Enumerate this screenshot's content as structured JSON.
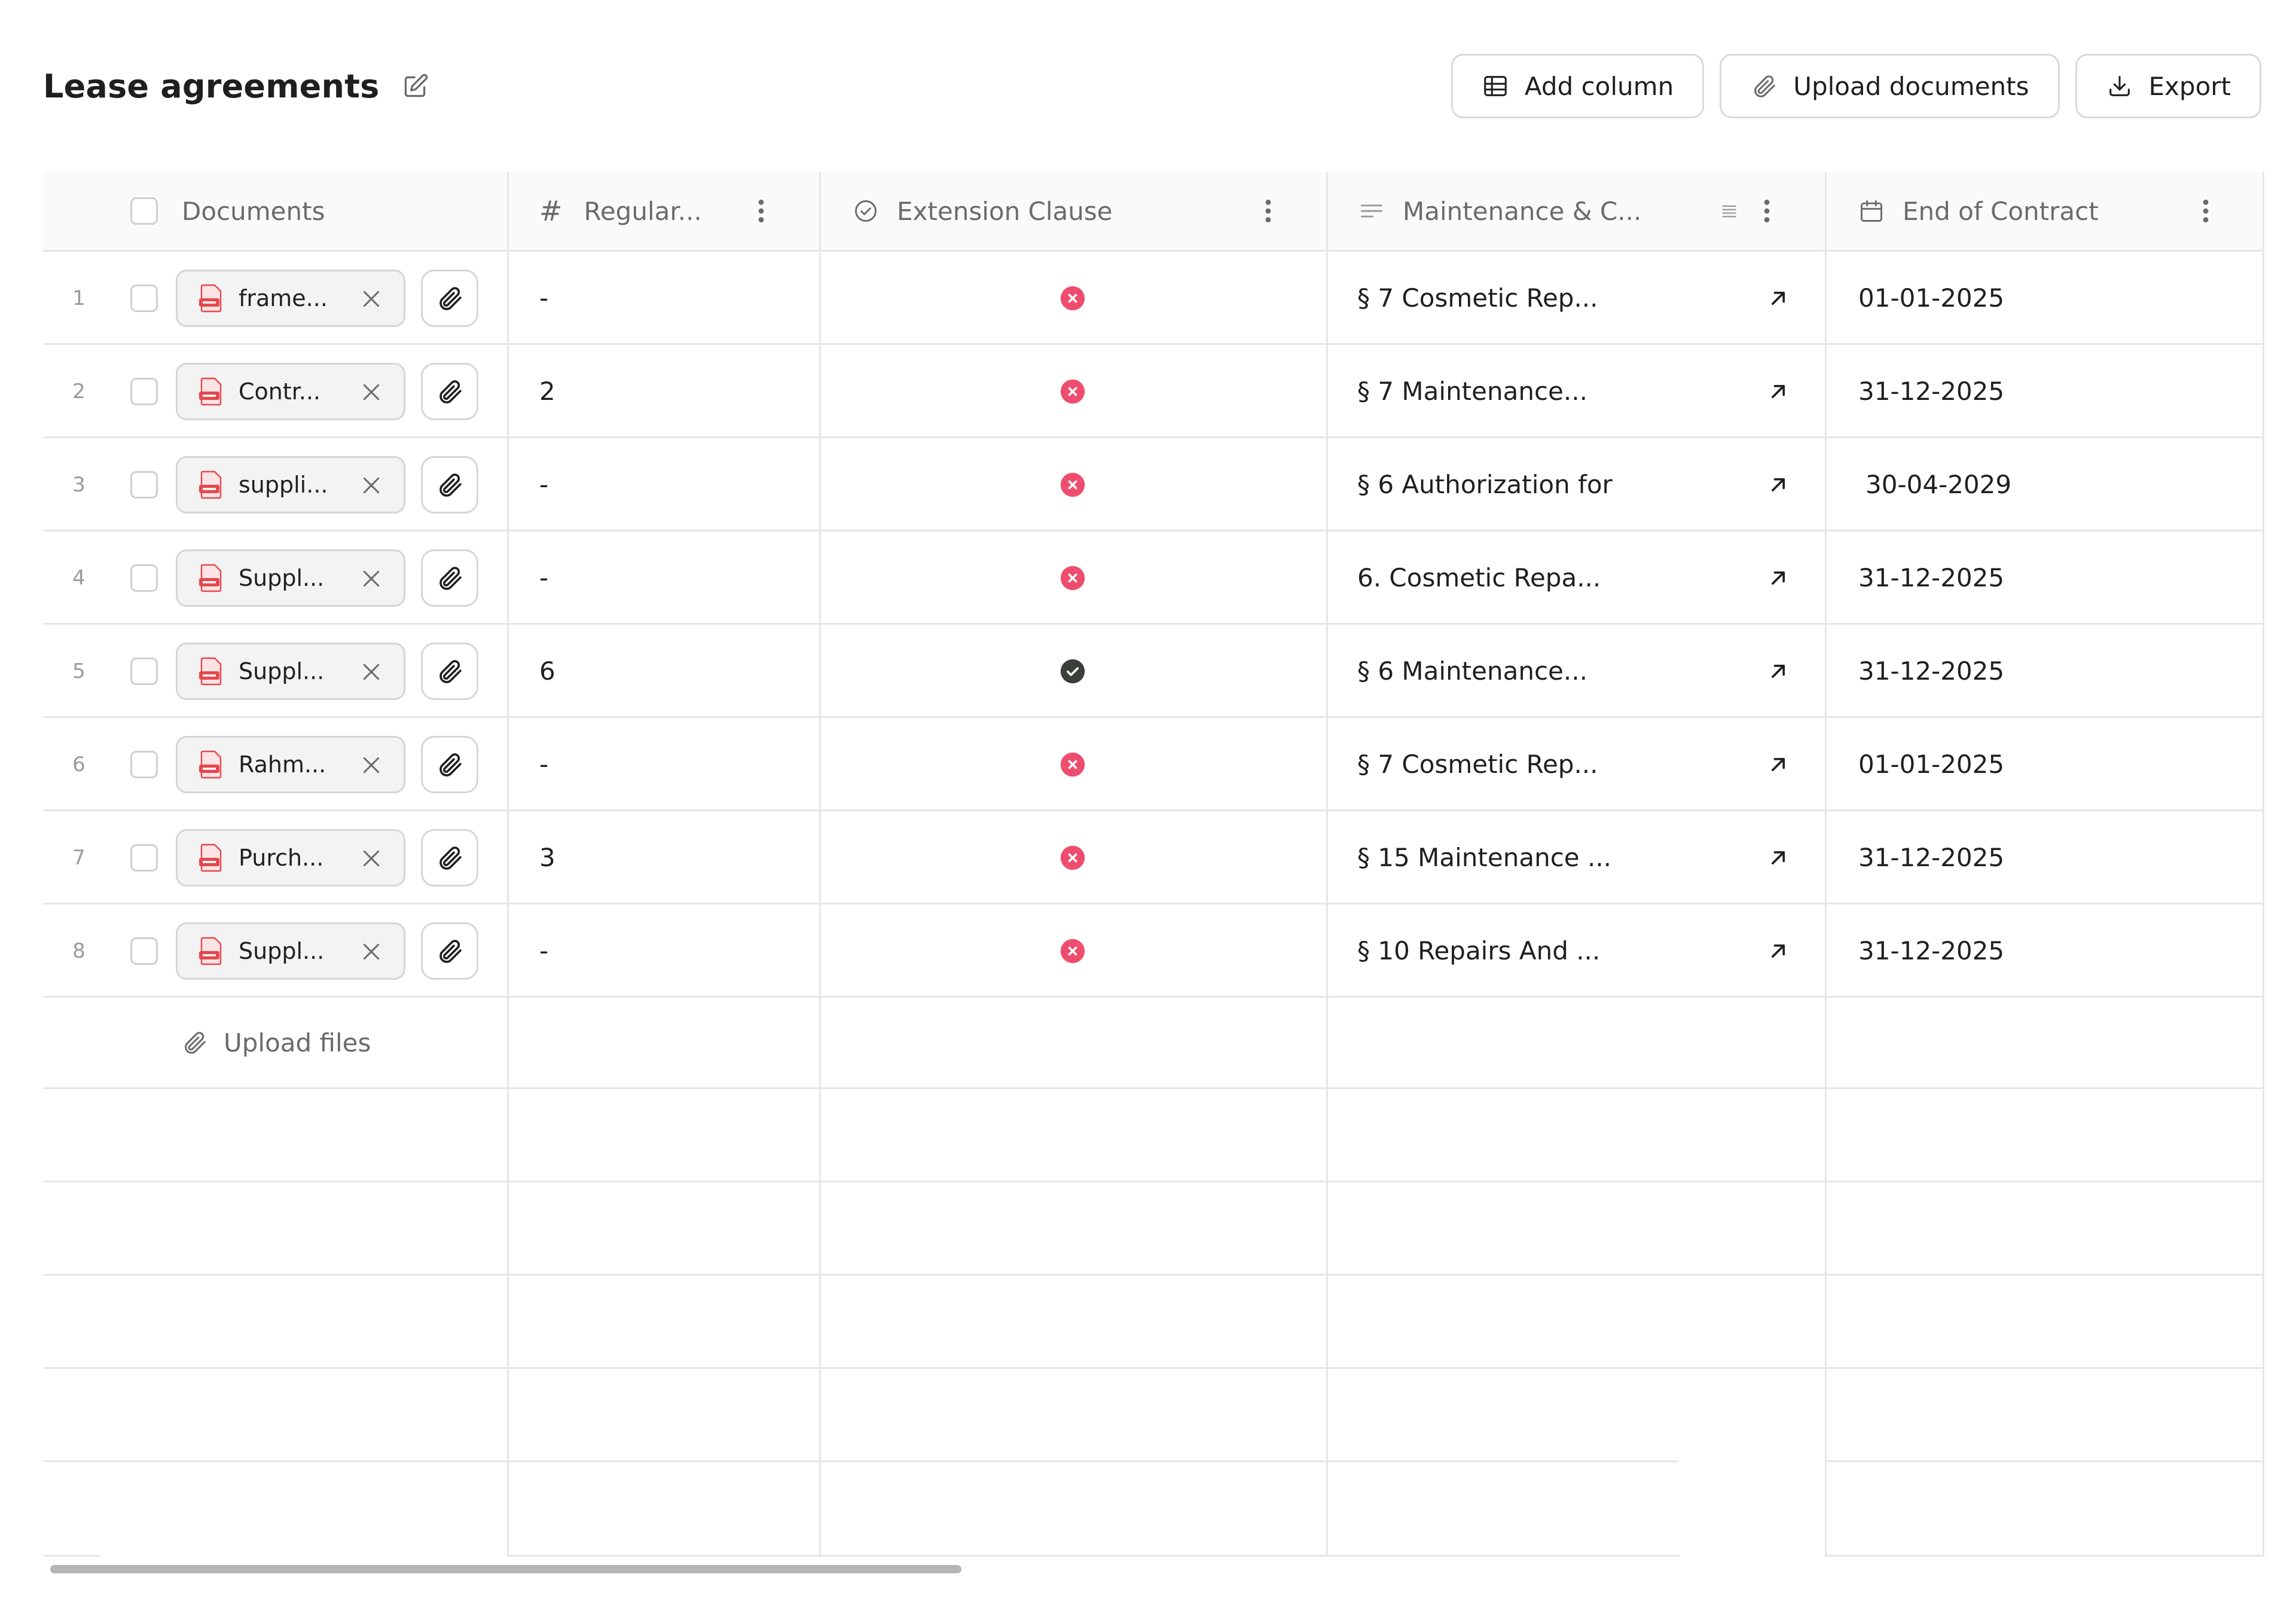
{
  "header": {
    "title": "Lease agreements",
    "edit_icon": "edit-icon"
  },
  "toolbar": {
    "add_column": "Add column",
    "upload_documents": "Upload documents",
    "export": "Export"
  },
  "columns": {
    "documents": "Documents",
    "regular": "Regular...",
    "extension": "Extension Clause",
    "maintenance": "Maintenance & C...",
    "end": "End of Contract"
  },
  "rows": [
    {
      "num": "1",
      "file": "frame...",
      "regular": "-",
      "extension": false,
      "maintenance": "§ 7 Cosmetic Rep...",
      "end": "01-01-2025"
    },
    {
      "num": "2",
      "file": "Contr...",
      "regular": "2",
      "extension": false,
      "maintenance": "§ 7 Maintenance...",
      "end": "31-12-2025"
    },
    {
      "num": "3",
      "file": "suppli...",
      "regular": "-",
      "extension": false,
      "maintenance": "§ 6 Authorization for",
      "end": "30-04-2029"
    },
    {
      "num": "4",
      "file": "Suppl...",
      "regular": "-",
      "extension": false,
      "maintenance": "6. Cosmetic Repa...",
      "end": "31-12-2025"
    },
    {
      "num": "5",
      "file": "Suppl...",
      "regular": "6",
      "extension": true,
      "maintenance": "§ 6 Maintenance...",
      "end": "31-12-2025"
    },
    {
      "num": "6",
      "file": "Rahm...",
      "regular": "-",
      "extension": false,
      "maintenance": "§ 7 Cosmetic Rep...",
      "end": "01-01-2025"
    },
    {
      "num": "7",
      "file": "Purch...",
      "regular": "3",
      "extension": false,
      "maintenance": "§ 15 Maintenance ...",
      "end": "31-12-2025"
    },
    {
      "num": "8",
      "file": "Suppl...",
      "regular": "-",
      "extension": false,
      "maintenance": "§ 10 Repairs And ...",
      "end": "31-12-2025"
    }
  ],
  "upload_files": "Upload files",
  "colors": {
    "status_no": "#ef4d6d",
    "status_yes": "#3a3f3a",
    "pdf_red": "#e5484d",
    "border": "#e6e6e6"
  }
}
